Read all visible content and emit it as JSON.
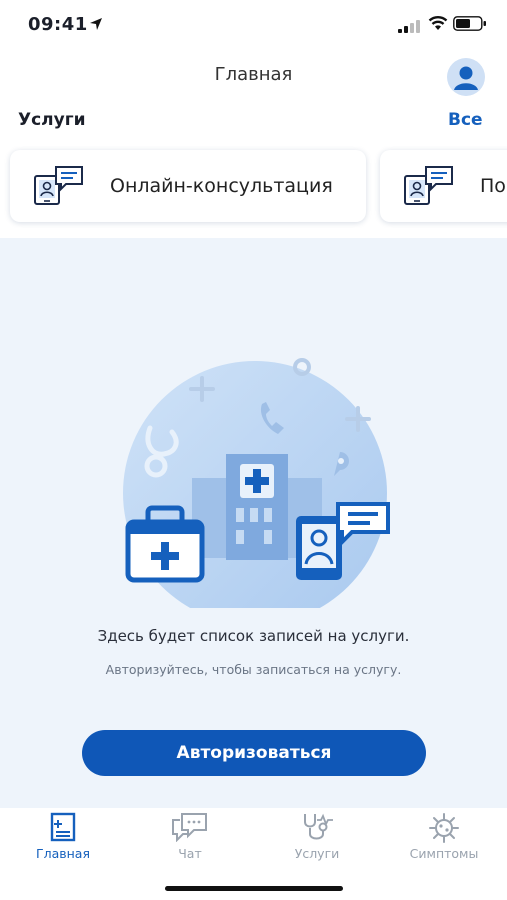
{
  "status_bar": {
    "time": "09:41"
  },
  "navbar": {
    "title": "Главная"
  },
  "services": {
    "title": "Услуги",
    "all_link": "Все",
    "cards": [
      {
        "label": "Онлайн-консультация",
        "icon": "chat-doctor-icon"
      },
      {
        "label": "По",
        "icon": "chat-doctor-icon"
      }
    ]
  },
  "empty_state": {
    "title": "Здесь будет список записей на услуги.",
    "subtitle": "Авторизуйтесь, чтобы записаться на услугу.",
    "button": "Авторизоваться"
  },
  "tabbar": {
    "tabs": [
      {
        "label": "Главная",
        "icon": "home-document-icon",
        "active": true
      },
      {
        "label": "Чат",
        "icon": "chat-bubble-icon",
        "active": false
      },
      {
        "label": "Услуги",
        "icon": "stethoscope-icon",
        "active": false
      },
      {
        "label": "Симптомы",
        "icon": "virus-icon",
        "active": false
      }
    ]
  },
  "colors": {
    "accent": "#1560bd",
    "button": "#0f57b7",
    "background": "#eef4fb",
    "inactive": "#9aa3ae"
  }
}
